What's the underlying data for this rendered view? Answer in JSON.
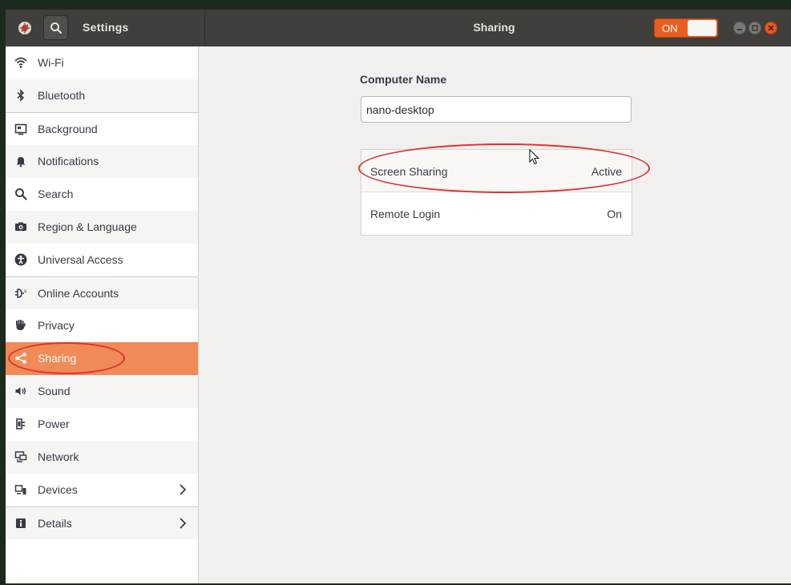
{
  "window": {
    "app_title": "Settings",
    "panel_title": "Sharing",
    "master_toggle": {
      "label": "ON",
      "state": "on"
    },
    "accent_color": "#f08a57"
  },
  "sidebar": {
    "items": [
      {
        "label": "Wi-Fi",
        "icon": "wifi-icon"
      },
      {
        "label": "Bluetooth",
        "icon": "bluetooth-icon"
      },
      {
        "label": "Background",
        "icon": "background-icon"
      },
      {
        "label": "Notifications",
        "icon": "bell-icon"
      },
      {
        "label": "Search",
        "icon": "search-icon"
      },
      {
        "label": "Region & Language",
        "icon": "camera-icon"
      },
      {
        "label": "Universal Access",
        "icon": "accessibility-icon"
      },
      {
        "label": "Online Accounts",
        "icon": "online-accounts-icon"
      },
      {
        "label": "Privacy",
        "icon": "hand-icon"
      },
      {
        "label": "Sharing",
        "icon": "share-icon",
        "selected": true
      },
      {
        "label": "Sound",
        "icon": "speaker-icon"
      },
      {
        "label": "Power",
        "icon": "power-plug-icon"
      },
      {
        "label": "Network",
        "icon": "network-icon"
      },
      {
        "label": "Devices",
        "icon": "devices-icon",
        "has_submenu": true
      },
      {
        "label": "Details",
        "icon": "info-icon",
        "has_submenu": true
      }
    ]
  },
  "main": {
    "computer_name_label": "Computer Name",
    "computer_name_value": "nano-desktop",
    "rows": [
      {
        "label": "Screen Sharing",
        "value": "Active"
      },
      {
        "label": "Remote Login",
        "value": "On"
      }
    ]
  }
}
